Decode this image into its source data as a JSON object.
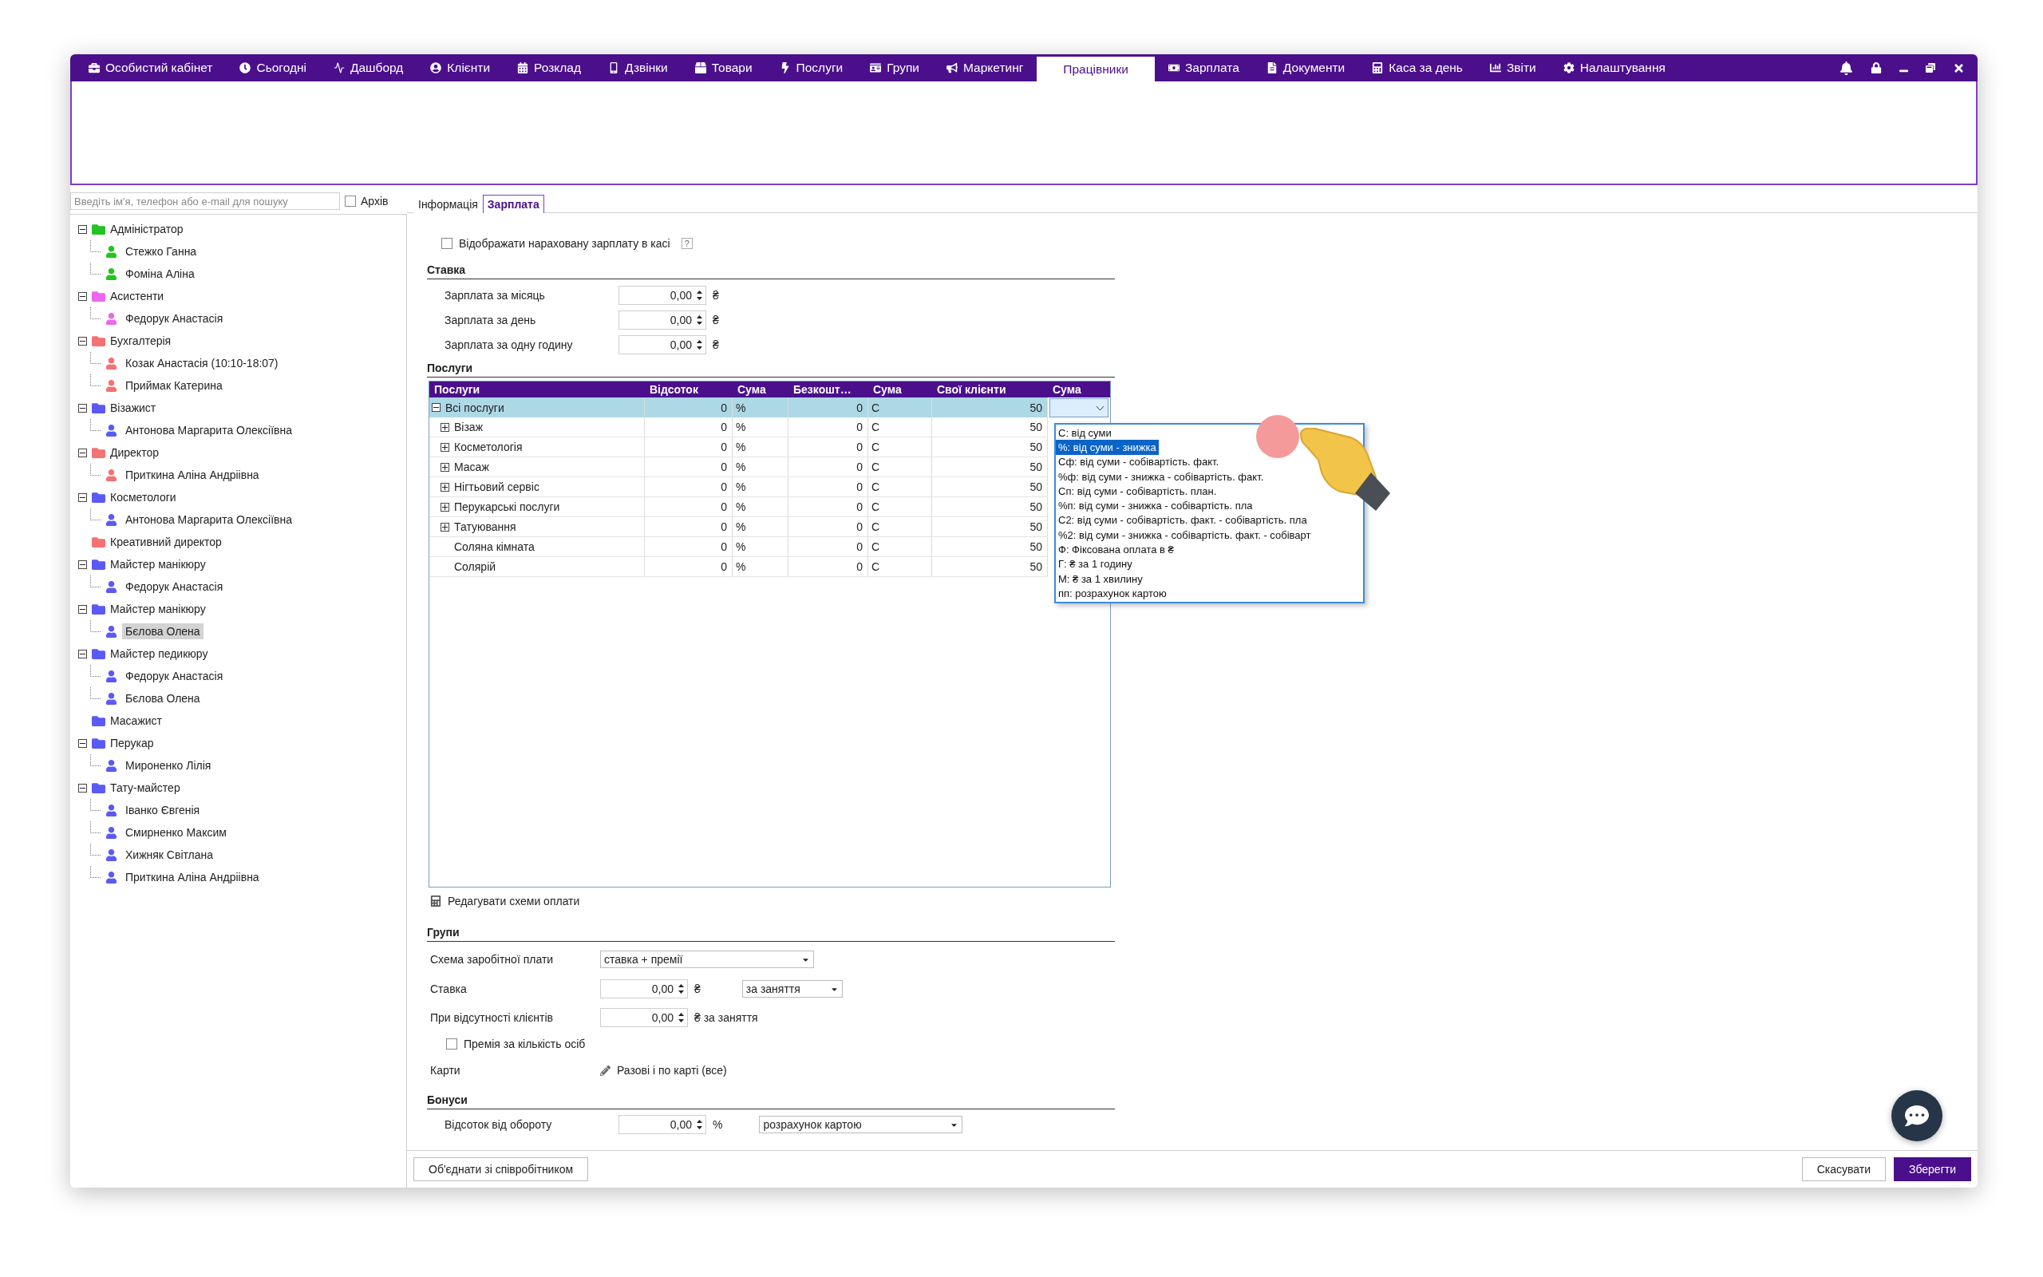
{
  "nav": [
    {
      "label": "Особистий кабінет",
      "selected": false
    },
    {
      "label": "Сьогодні",
      "selected": false
    },
    {
      "label": "Дашборд",
      "selected": false
    },
    {
      "label": "Клієнти",
      "selected": false
    },
    {
      "label": "Розклад",
      "selected": false
    },
    {
      "label": "Дзвінки",
      "selected": false
    },
    {
      "label": "Товари",
      "selected": false
    },
    {
      "label": "Послуги",
      "selected": false
    },
    {
      "label": "Групи",
      "selected": false
    },
    {
      "label": "Маркетинг",
      "selected": false
    },
    {
      "label": "Працівники",
      "selected": true
    },
    {
      "label": "Зарплата",
      "selected": false
    },
    {
      "label": "Документи",
      "selected": false
    },
    {
      "label": "Каса за день",
      "selected": false
    },
    {
      "label": "Звіти",
      "selected": false
    },
    {
      "label": "Налаштування",
      "selected": false
    }
  ],
  "search": {
    "placeholder": "Введіть ім'я, телефон або e-mail для пошуку"
  },
  "archive": {
    "label": "Архів",
    "checked": false
  },
  "tree": [
    {
      "label": "Адміністратор",
      "color": "#22c422",
      "expanded": true,
      "children": [
        {
          "label": "Стежко Ганна",
          "selected": false
        },
        {
          "label": "Фоміна Аліна",
          "selected": false
        }
      ]
    },
    {
      "label": "Асистенти",
      "color": "#ee66ee",
      "expanded": true,
      "children": [
        {
          "label": "Федорук Анастасія",
          "selected": false
        }
      ]
    },
    {
      "label": "Бухгалтерія",
      "color": "#f47272",
      "expanded": true,
      "children": [
        {
          "label": "Козак Анастасія (10:10-18:07)",
          "selected": false
        },
        {
          "label": "Приймак Катерина",
          "selected": false
        }
      ]
    },
    {
      "label": "Візажист",
      "color": "#5a5af5",
      "expanded": true,
      "children": [
        {
          "label": "Антонова Маргарита Олексіївна",
          "selected": false
        }
      ]
    },
    {
      "label": "Директор",
      "color": "#f47272",
      "expanded": true,
      "children": [
        {
          "label": "Приткина Аліна Андріівна",
          "selected": false
        }
      ]
    },
    {
      "label": "Косметологи",
      "color": "#5a5af5",
      "expanded": true,
      "children": [
        {
          "label": "Антонова Маргарита Олексіївна",
          "selected": false
        }
      ]
    },
    {
      "label": "Креативний директор",
      "color": "#f47272"
    },
    {
      "label": "Майстер манікюру",
      "color": "#5a5af5",
      "expanded": true,
      "children": [
        {
          "label": "Федорук Анастасія",
          "selected": false
        }
      ]
    },
    {
      "label": "Майстер манікюру",
      "color": "#5a5af5",
      "expanded": true,
      "children": [
        {
          "label": "Бєлова Олена",
          "selected": true
        }
      ]
    },
    {
      "label": "Майстер педикюру",
      "color": "#5a5af5",
      "expanded": true,
      "children": [
        {
          "label": "Федорук Анастасія",
          "selected": false
        },
        {
          "label": "Бєлова Олена",
          "selected": false
        }
      ]
    },
    {
      "label": "Масажист",
      "color": "#5a5af5"
    },
    {
      "label": "Перукар",
      "color": "#5a5af5",
      "expanded": true,
      "children": [
        {
          "label": "Мироненко Лілія",
          "selected": false
        }
      ]
    },
    {
      "label": "Тату-майстер",
      "color": "#5a5af5",
      "expanded": true,
      "children": [
        {
          "label": "Іванко Євгенія",
          "selected": false
        },
        {
          "label": "Смирненко Максим",
          "selected": false
        },
        {
          "label": "Хижняк Світлана",
          "selected": false
        },
        {
          "label": "Приткина Аліна Андріівна",
          "selected": false
        }
      ]
    }
  ],
  "tabs": [
    {
      "label": "Інформація",
      "selected": false
    },
    {
      "label": "Зарплата",
      "selected": true
    }
  ],
  "show_salary": {
    "label": "Відображати нараховану зарплату в касі",
    "checked": false,
    "help": "?"
  },
  "rate": {
    "title": "Ставка",
    "rows": [
      {
        "label": "Зарплата за місяць",
        "value": "0,00",
        "unit": "₴"
      },
      {
        "label": "Зарплата за день",
        "value": "0,00",
        "unit": "₴"
      },
      {
        "label": "Зарплата за одну годину",
        "value": "0,00",
        "unit": "₴"
      }
    ]
  },
  "services": {
    "title": "Послуги",
    "columns": [
      "Послуги",
      "Відсоток",
      "Сума",
      "Безкошт…",
      "Сума",
      "Свої клієнти",
      "Сума"
    ],
    "rows": [
      {
        "name": "Всі послуги",
        "percent": "0",
        "percent_unit": "%",
        "free": "0",
        "free_unit": "C",
        "own": "50",
        "selected": true,
        "expanded": true,
        "children": [
          {
            "name": "Візаж",
            "percent": "0",
            "percent_unit": "%",
            "free": "0",
            "free_unit": "C",
            "own": "50",
            "selected": false,
            "expanded": false
          },
          {
            "name": "Косметологія",
            "percent": "0",
            "percent_unit": "%",
            "free": "0",
            "free_unit": "C",
            "own": "50",
            "selected": false,
            "expanded": false
          },
          {
            "name": "Масаж",
            "percent": "0",
            "percent_unit": "%",
            "free": "0",
            "free_unit": "C",
            "own": "50",
            "selected": false,
            "expanded": false
          },
          {
            "name": "Нігтьовий сервіс",
            "percent": "0",
            "percent_unit": "%",
            "free": "0",
            "free_unit": "C",
            "own": "50",
            "selected": false,
            "expanded": false
          },
          {
            "name": "Перукарські послуги",
            "percent": "0",
            "percent_unit": "%",
            "free": "0",
            "free_unit": "C",
            "own": "50",
            "selected": false,
            "expanded": false
          },
          {
            "name": "Татуювання",
            "percent": "0",
            "percent_unit": "%",
            "free": "0",
            "free_unit": "C",
            "own": "50",
            "selected": false,
            "expanded": false
          },
          {
            "name": "Соляна кімната",
            "percent": "0",
            "percent_unit": "%",
            "free": "0",
            "free_unit": "C",
            "own": "50",
            "selected": false
          },
          {
            "name": "Солярій",
            "percent": "0",
            "percent_unit": "%",
            "free": "0",
            "free_unit": "C",
            "own": "50",
            "selected": false
          }
        ]
      }
    ],
    "dropdown": [
      {
        "label": "С: від суми",
        "selected": false
      },
      {
        "label": "%: від суми - знижка",
        "selected": true
      },
      {
        "label": "Сф: від суми - собівартість. факт.",
        "selected": false
      },
      {
        "label": "%ф: від суми - знижка - собівартість. факт.",
        "selected": false
      },
      {
        "label": "Сп: від суми - собівартість. план.",
        "selected": false
      },
      {
        "label": "%п: від суми - знижка - собівартість. пла",
        "selected": false
      },
      {
        "label": "С2: від суми - собівартість. факт. - собівартість. пла",
        "selected": false
      },
      {
        "label": "%2: від суми - знижка - собівартість. факт. - собіварт",
        "selected": false
      },
      {
        "label": "Ф: Фіксована оплата в ₴",
        "selected": false
      },
      {
        "label": "Г: ₴ за 1 годину",
        "selected": false
      },
      {
        "label": "М: ₴ за 1 хвилину",
        "selected": false
      },
      {
        "label": "пп: розрахунок картою",
        "selected": false
      }
    ]
  },
  "edit_schemes": "Редагувати схеми оплати",
  "groups": {
    "title": "Групи",
    "scheme": {
      "label": "Схема заробітної плати",
      "value": "ставка + премії"
    },
    "rate": {
      "label": "Ставка",
      "value": "0,00",
      "unit": "₴",
      "period": "за заняття"
    },
    "absence": {
      "label": "При відсутності клієнтів",
      "value": "0,00",
      "unit": "₴ за заняття"
    },
    "per_person": {
      "label": "Премія за кількість осіб",
      "checked": false
    },
    "cards": {
      "label": "Карти",
      "value": "Разові і по карті (все)"
    }
  },
  "bonuses": {
    "title": "Бонуси",
    "turnover": {
      "label": "Відсоток від обороту",
      "value": "0,00",
      "unit": "%",
      "mode": "розрахунок картою"
    }
  },
  "footer": {
    "merge": "Об'єднати зі співробітником",
    "cancel": "Скасувати",
    "save": "Зберегти"
  }
}
